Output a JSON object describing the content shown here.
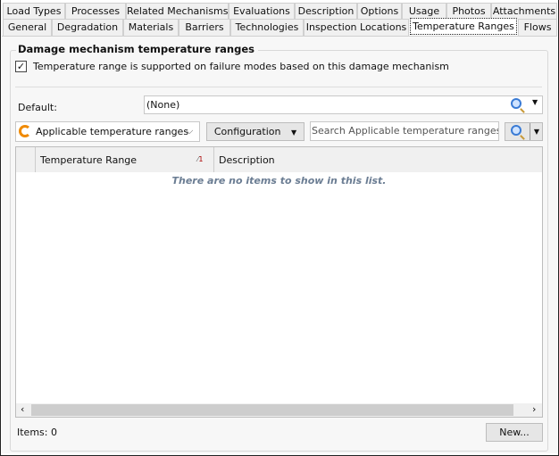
{
  "tabs_row1": [
    "Load Types",
    "Processes",
    "Related Mechanisms",
    "Evaluations",
    "Description",
    "Options",
    "Usage",
    "Photos",
    "Attachments"
  ],
  "tabs_row2": [
    "General",
    "Degradation",
    "Materials",
    "Barriers",
    "Technologies",
    "Inspection Locations",
    "Temperature Ranges",
    "Flows"
  ],
  "group": {
    "title": "Damage mechanism temperature ranges",
    "checkbox_label": "Temperature range is supported on failure modes based on this damage mechanism",
    "checked": true
  },
  "default": {
    "label": "Default:",
    "value": "(None)"
  },
  "toolbar": {
    "view": "Applicable temperature ranges",
    "configuration": "Configuration",
    "search_placeholder": "Search Applicable temperature ranges  (Ctrl"
  },
  "grid": {
    "columns": [
      "Temperature Range",
      "Description"
    ],
    "sort_index": "1",
    "empty": "There are no items to show in this list."
  },
  "footer": {
    "items": "Items: 0",
    "new": "New..."
  }
}
